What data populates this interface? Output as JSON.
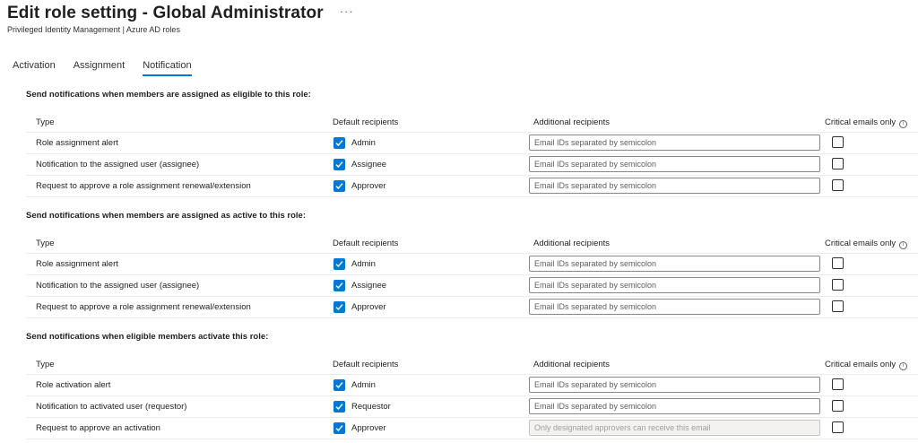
{
  "header": {
    "title": "Edit role setting - Global Administrator",
    "more": "···",
    "subtitle": "Privileged Identity Management | Azure AD roles"
  },
  "tabs": [
    {
      "label": "Activation",
      "active": false
    },
    {
      "label": "Assignment",
      "active": false
    },
    {
      "label": "Notification",
      "active": true
    }
  ],
  "columns": {
    "type": "Type",
    "default": "Default recipients",
    "additional": "Additional recipients",
    "critical": "Critical emails only"
  },
  "sections": [
    {
      "title": "Send notifications when members are assigned as eligible to this role:",
      "rows": [
        {
          "type": "Role assignment alert",
          "recipient": "Admin",
          "recipient_checked": true,
          "placeholder": "Email IDs separated by semicolon",
          "disabled": false,
          "critical": false
        },
        {
          "type": "Notification to the assigned user (assignee)",
          "recipient": "Assignee",
          "recipient_checked": true,
          "placeholder": "Email IDs separated by semicolon",
          "disabled": false,
          "critical": false
        },
        {
          "type": "Request to approve a role assignment renewal/extension",
          "recipient": "Approver",
          "recipient_checked": true,
          "placeholder": "Email IDs separated by semicolon",
          "disabled": false,
          "critical": false
        }
      ]
    },
    {
      "title": "Send notifications when members are assigned as active to this role:",
      "rows": [
        {
          "type": "Role assignment alert",
          "recipient": "Admin",
          "recipient_checked": true,
          "placeholder": "Email IDs separated by semicolon",
          "disabled": false,
          "critical": false
        },
        {
          "type": "Notification to the assigned user (assignee)",
          "recipient": "Assignee",
          "recipient_checked": true,
          "placeholder": "Email IDs separated by semicolon",
          "disabled": false,
          "critical": false
        },
        {
          "type": "Request to approve a role assignment renewal/extension",
          "recipient": "Approver",
          "recipient_checked": true,
          "placeholder": "Email IDs separated by semicolon",
          "disabled": false,
          "critical": false
        }
      ]
    },
    {
      "title": "Send notifications when eligible members activate this role:",
      "rows": [
        {
          "type": "Role activation alert",
          "recipient": "Admin",
          "recipient_checked": true,
          "placeholder": "Email IDs separated by semicolon",
          "disabled": false,
          "critical": false
        },
        {
          "type": "Notification to activated user (requestor)",
          "recipient": "Requestor",
          "recipient_checked": true,
          "placeholder": "Email IDs separated by semicolon",
          "disabled": false,
          "critical": false
        },
        {
          "type": "Request to approve an activation",
          "recipient": "Approver",
          "recipient_checked": true,
          "placeholder": "Only designated approvers can receive this email",
          "disabled": true,
          "critical": false
        }
      ]
    }
  ],
  "colors": {
    "accent": "#0078d4",
    "text": "#201f1e",
    "border": "#edebe9"
  }
}
